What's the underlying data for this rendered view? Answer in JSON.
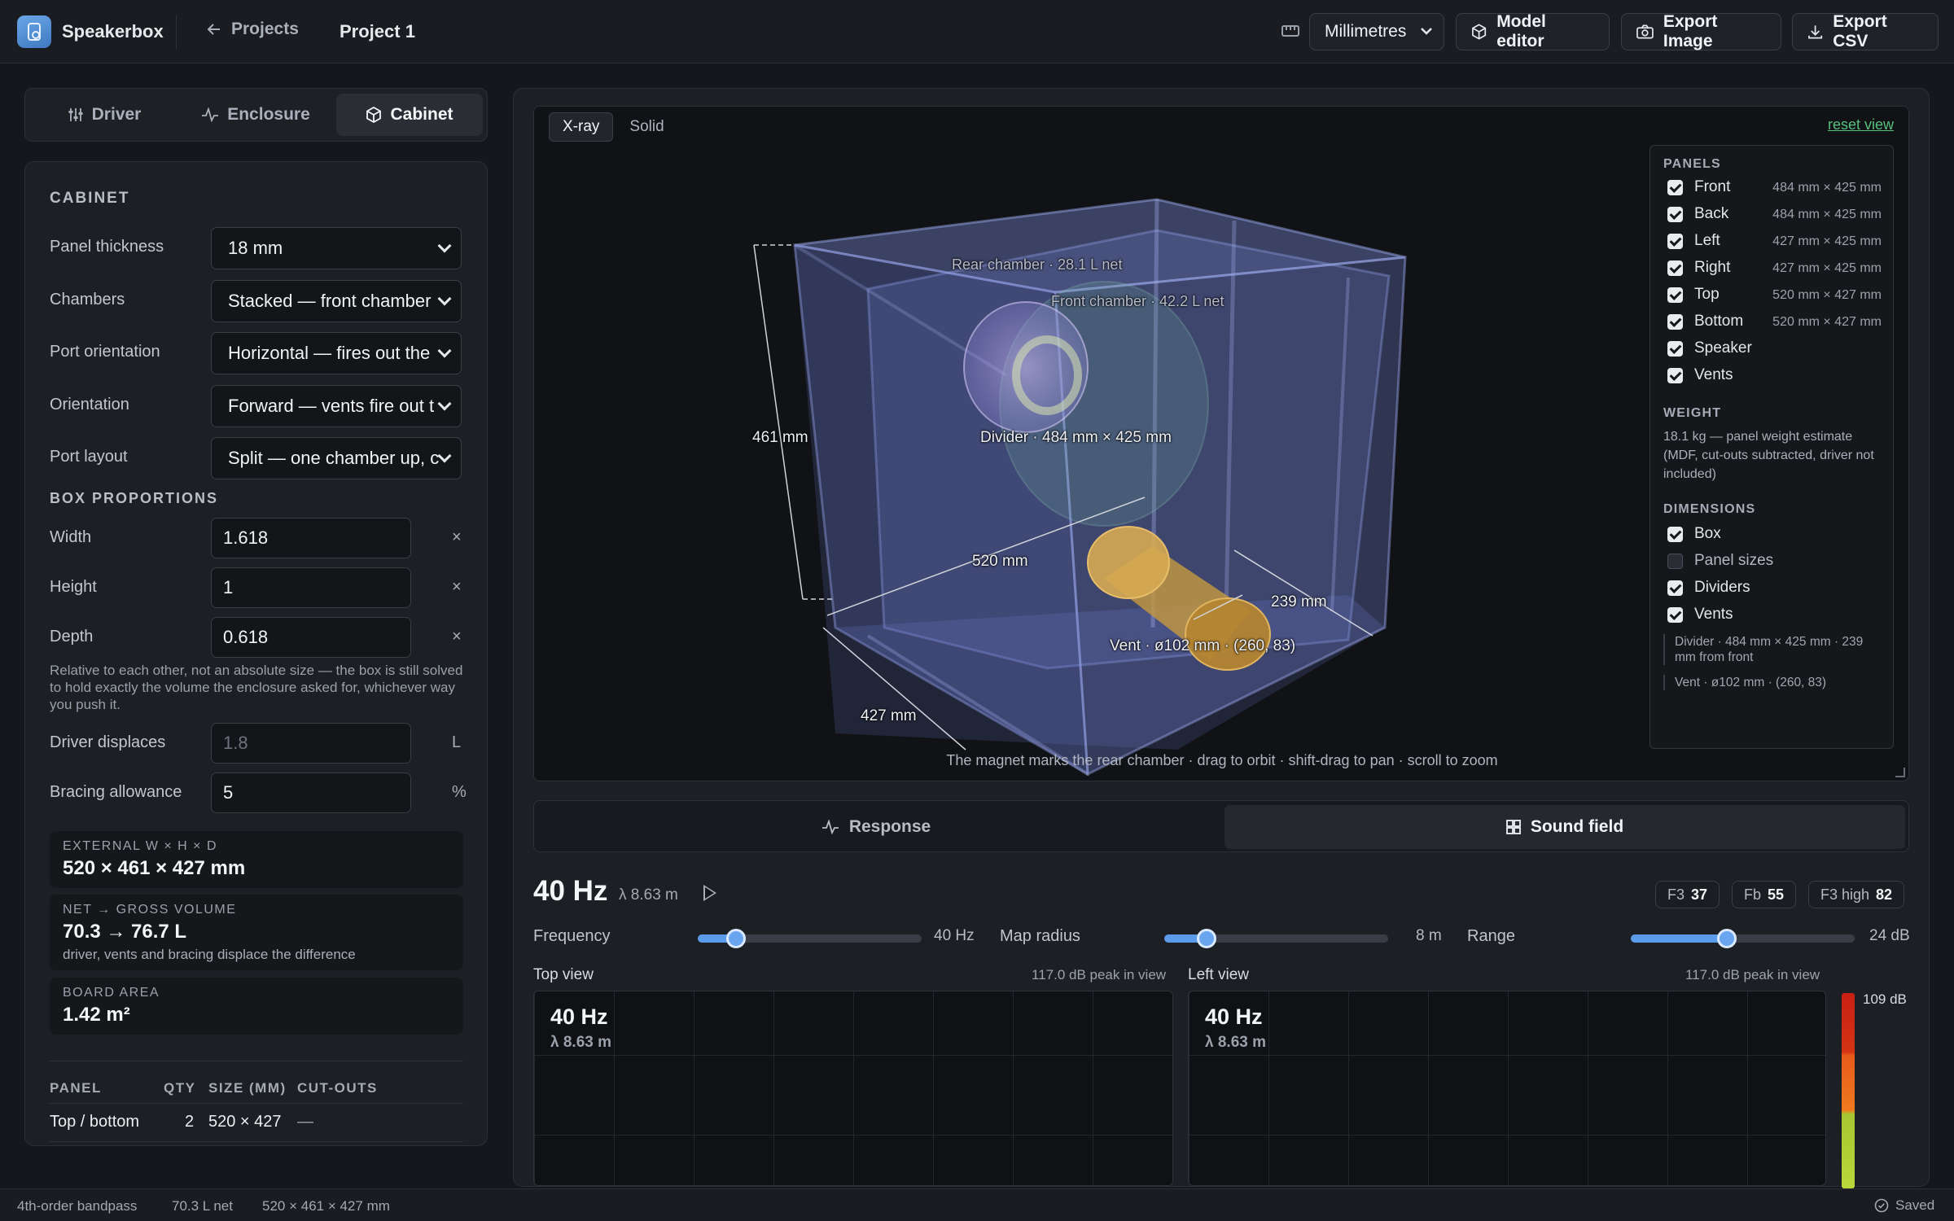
{
  "app": {
    "name": "Speakerbox"
  },
  "header": {
    "back_label": "Projects",
    "project_title": "Project 1",
    "units_selected": "Millimetres",
    "model_editor": "Model editor",
    "export_image": "Export Image",
    "export_csv": "Export CSV"
  },
  "left_tabs": [
    "Driver",
    "Enclosure",
    "Cabinet"
  ],
  "cabinet": {
    "title": "CABINET",
    "fields": [
      {
        "label": "Panel thickness",
        "value": "18 mm"
      },
      {
        "label": "Chambers",
        "value": "Stacked — front chamber"
      },
      {
        "label": "Port orientation",
        "value": "Horizontal — fires out the"
      },
      {
        "label": "Orientation",
        "value": "Forward — vents fire out t"
      },
      {
        "label": "Port layout",
        "value": "Split — one chamber up, c"
      }
    ],
    "box_heading": "BOX PROPORTIONS",
    "proportions": [
      {
        "label": "Width",
        "value": "1.618",
        "unit": "×"
      },
      {
        "label": "Height",
        "value": "1",
        "unit": "×"
      },
      {
        "label": "Depth",
        "value": "0.618",
        "unit": "×"
      }
    ],
    "hint": "Relative to each other, not an absolute size — the box is still solved to hold exactly the volume the enclosure asked for, whichever way you push it.",
    "driver_displaces": {
      "label": "Driver displaces",
      "placeholder": "1.8",
      "unit": "L"
    },
    "bracing": {
      "label": "Bracing allowance",
      "value": "5",
      "unit": "%"
    },
    "stats": [
      {
        "key": "EXTERNAL W × H × D",
        "value": "520 × 461 × 427 mm",
        "sub": ""
      },
      {
        "key": "NET → GROSS VOLUME",
        "value": "70.3 → 76.7 L",
        "sub": "driver, vents and bracing displace the difference"
      },
      {
        "key": "BOARD AREA",
        "value": "1.42 m²",
        "sub": ""
      }
    ],
    "table": {
      "headers": [
        "PANEL",
        "QTY",
        "SIZE (MM)",
        "CUT-OUTS"
      ],
      "rows": [
        {
          "panel": "Top / bottom",
          "qty": "2",
          "size": "520 × 427",
          "cutouts": "—"
        }
      ]
    }
  },
  "viewport": {
    "modes": [
      "X-ray",
      "Solid"
    ],
    "reset": "reset view",
    "labels": {
      "rear_chamber": "Rear chamber · 28.1 L net",
      "front_chamber": "Front chamber · 42.2 L net",
      "height": "461 mm",
      "divider": "Divider · 484 mm × 425 mm",
      "width": "520 mm",
      "depth_back": "239 mm",
      "vent": "Vent · ø102 mm · (260, 83)",
      "depth": "427 mm"
    },
    "caption": "The magnet marks the rear chamber · drag to orbit · shift-drag to pan · scroll to zoom",
    "panels_heading": "PANELS",
    "panels": [
      {
        "name": "Front",
        "dim": "484 mm × 425 mm",
        "checked": true
      },
      {
        "name": "Back",
        "dim": "484 mm × 425 mm",
        "checked": true
      },
      {
        "name": "Left",
        "dim": "427 mm × 425 mm",
        "checked": true
      },
      {
        "name": "Right",
        "dim": "427 mm × 425 mm",
        "checked": true
      },
      {
        "name": "Top",
        "dim": "520 mm × 427 mm",
        "checked": true
      },
      {
        "name": "Bottom",
        "dim": "520 mm × 427 mm",
        "checked": true
      },
      {
        "name": "Speaker",
        "dim": "",
        "checked": true
      },
      {
        "name": "Vents",
        "dim": "",
        "checked": true
      }
    ],
    "weight_heading": "WEIGHT",
    "weight_text": "18.1 kg — panel weight estimate (MDF, cut-outs subtracted, driver not included)",
    "dimensions_heading": "DIMENSIONS",
    "dimensions": [
      {
        "name": "Box",
        "checked": true
      },
      {
        "name": "Panel sizes",
        "checked": false
      },
      {
        "name": "Dividers",
        "checked": true
      },
      {
        "name": "Vents",
        "checked": true
      }
    ],
    "dim_notes": [
      "Divider · 484 mm × 425 mm · 239 mm from front",
      "Vent · ø102 mm · (260, 83)"
    ]
  },
  "analysis": {
    "tabs": [
      "Response",
      "Sound field"
    ],
    "frequency": "40 Hz",
    "lambda": "λ 8.63 m",
    "chips": [
      {
        "label": "F3",
        "value": "37"
      },
      {
        "label": "Fb",
        "value": "55"
      },
      {
        "label": "F3 high",
        "value": "82"
      }
    ],
    "controls": [
      {
        "label": "Frequency",
        "value": "40 Hz",
        "level": 0.17
      },
      {
        "label": "Map radius",
        "value": "8 m",
        "level": 0.19
      },
      {
        "label": "Range",
        "value": "24 dB",
        "level": 0.43
      }
    ],
    "plots": [
      {
        "title": "Top view",
        "peak": "117.0 dB peak in view",
        "hz": "40 Hz",
        "lambda": "λ 8.63 m"
      },
      {
        "title": "Left view",
        "peak": "117.0 dB peak in view",
        "hz": "40 Hz",
        "lambda": "λ 8.63 m"
      }
    ],
    "scale_max": "109 dB"
  },
  "status": {
    "mode": "4th-order bandpass",
    "net": "70.3 L net",
    "size": "520 × 461 × 427 mm",
    "saved": "Saved"
  },
  "colors": {
    "accent": "#5b9bea",
    "link": "#57c07c",
    "vent": "#c79a3e",
    "box": "#7f8fd6"
  }
}
